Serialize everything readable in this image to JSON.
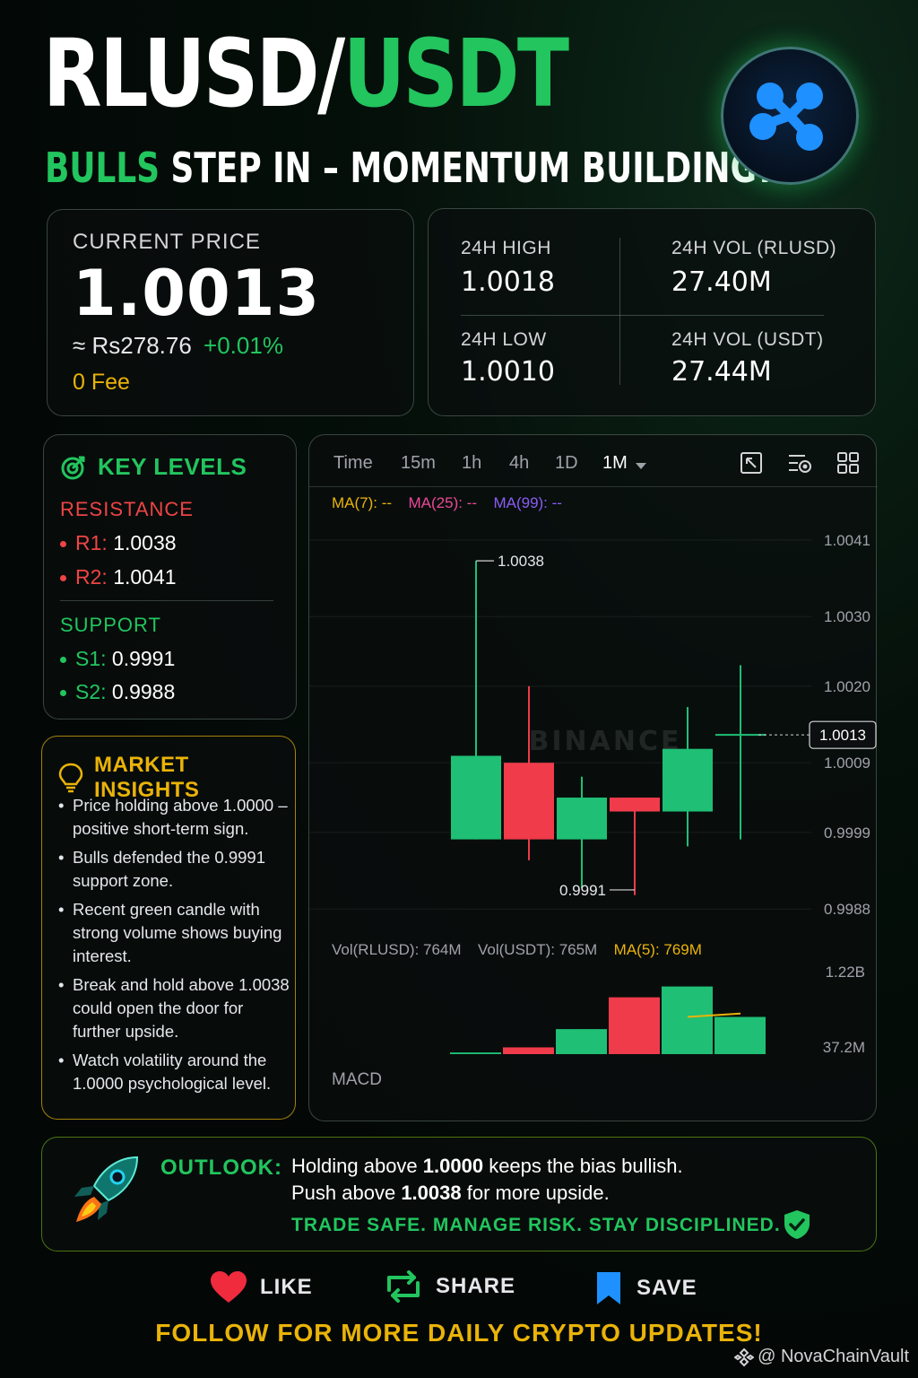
{
  "header": {
    "title_part1": "RLUSD/",
    "title_part2": "USDT",
    "subtitle_green": "BULLS",
    "subtitle_rest": " STEP IN – MOMENTUM BUILDING?",
    "logo_icon": "xrp-logo-icon"
  },
  "price": {
    "label": "CURRENT PRICE",
    "value": "1.0013",
    "fiat": "≈ Rs278.76",
    "change": "+0.01%",
    "fee": "0 Fee"
  },
  "stats": {
    "high_label": "24H HIGH",
    "high_value": "1.0018",
    "low_label": "24H LOW",
    "low_value": "1.0010",
    "vol_base_label": "24H VOL (RLUSD)",
    "vol_base_value": "27.40M",
    "vol_quote_label": "24H VOL (USDT)",
    "vol_quote_value": "27.44M"
  },
  "levels": {
    "title": "KEY LEVELS",
    "resistance_label": "RESISTANCE",
    "r1_key": "R1:",
    "r1_value": "1.0038",
    "r2_key": "R2:",
    "r2_value": "1.0041",
    "support_label": "SUPPORT",
    "s1_key": "S1:",
    "s1_value": "0.9991",
    "s2_key": "S2:",
    "s2_value": "0.9988"
  },
  "insights": {
    "title": "MARKET INSIGHTS",
    "items": [
      "Price holding above 1.0000 – positive short-term sign.",
      "Bulls defended the 0.9991 support zone.",
      "Recent green candle with strong volume shows buying interest.",
      "Break and hold above 1.0038 could open the door for further upside.",
      "Watch volatility around the 1.0000 psychological level."
    ]
  },
  "chart_toolbar": {
    "tabs": [
      "Time",
      "15m",
      "1h",
      "4h",
      "1D",
      "1M"
    ],
    "active_tab": "1M",
    "icons": [
      "expand-icon",
      "indicator-settings-icon",
      "grid-layout-icon"
    ]
  },
  "chart_data": {
    "type": "candlestick",
    "ma_labels": [
      "MA(7): --",
      "MA(25): --",
      "MA(99): --"
    ],
    "watermark": "BINANCE",
    "y_ticks": [
      "1.0041",
      "1.0030",
      "1.0020",
      "1.0009",
      "0.9999",
      "0.9988"
    ],
    "ylim": [
      0.9987,
      1.0046
    ],
    "current_price_label": "1.0013",
    "current_price": 1.0013,
    "high_annotation": "1.0038",
    "high_value": 1.0038,
    "low_annotation": "0.9991",
    "low_value": 0.9991,
    "candles": [
      {
        "open": 0.9998,
        "close": 1.001,
        "high": 1.0038,
        "low": 0.9998,
        "color": "green"
      },
      {
        "open": 1.0009,
        "close": 0.9998,
        "high": 1.002,
        "low": 0.9995,
        "color": "red"
      },
      {
        "open": 0.9998,
        "close": 1.0004,
        "high": 1.0007,
        "low": 0.9991,
        "color": "green"
      },
      {
        "open": 1.0004,
        "close": 1.0002,
        "high": 1.0003,
        "low": 0.999,
        "color": "red"
      },
      {
        "open": 1.0002,
        "close": 1.0011,
        "high": 1.0017,
        "low": 0.9997,
        "color": "green"
      },
      {
        "open": 1.0013,
        "close": 1.0013,
        "high": 1.0023,
        "low": 0.9998,
        "color": "green"
      }
    ],
    "volume": {
      "labels": [
        "Vol(RLUSD): 764M",
        "Vol(USDT): 765M",
        "MA(5): 769M"
      ],
      "y_ticks": [
        "1.22B",
        "37.2M"
      ],
      "ylim": [
        0,
        1.22
      ],
      "values": [
        0.025,
        0.1,
        0.37,
        0.84,
        1.0,
        0.55
      ],
      "colors": [
        "green",
        "red",
        "green",
        "red",
        "green",
        "green"
      ],
      "ma5": [
        0.55,
        0.6
      ]
    },
    "macd_label": "MACD"
  },
  "outlook": {
    "label": "OUTLOOK:",
    "line1_a": "Holding above ",
    "line1_b": "1.0000",
    "line1_c": " keeps the bias bullish.",
    "line2_a": "Push above ",
    "line2_b": "1.0038",
    "line2_c": " for more upside.",
    "tagline": "TRADE SAFE. MANAGE RISK. STAY DISCIPLINED."
  },
  "actions": {
    "like": "LIKE",
    "share": "SHARE",
    "save": "SAVE"
  },
  "footer": {
    "follow": "FOLLOW FOR MORE DAILY CRYPTO UPDATES!",
    "watermark": "@ NovaChainVault"
  },
  "colors": {
    "green": "#22c55e",
    "red": "#ef4444",
    "yellow": "#eab308",
    "candle_green": "#1fbf75",
    "candle_red": "#ef3b4a"
  }
}
